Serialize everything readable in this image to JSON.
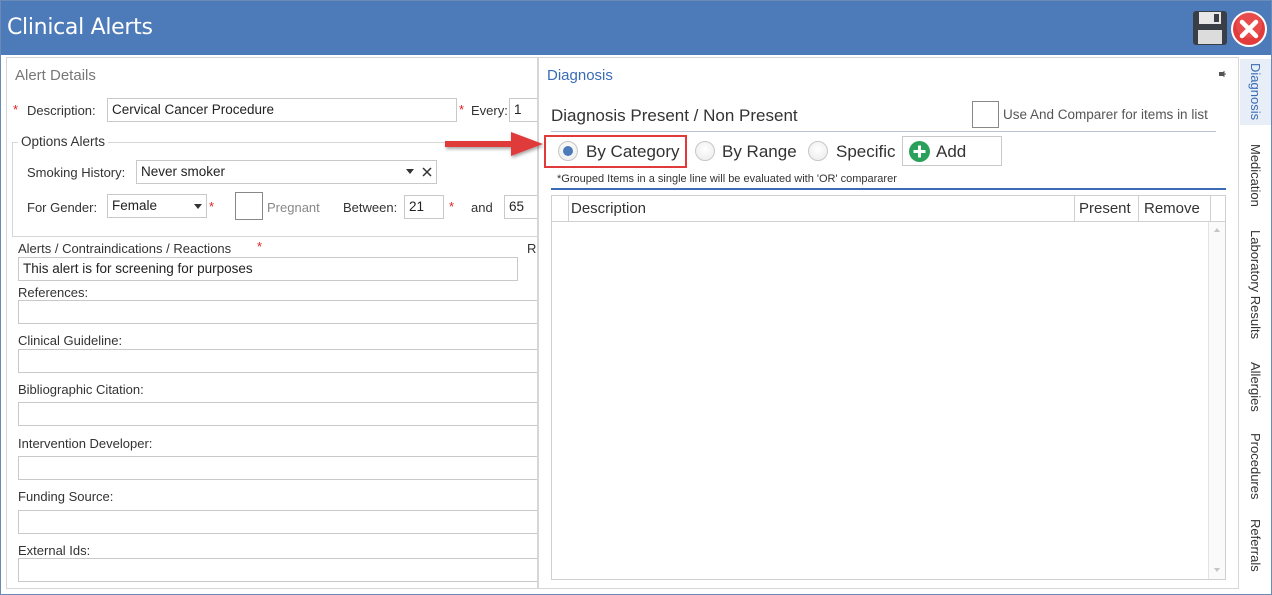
{
  "window": {
    "title": "Clinical Alerts"
  },
  "toolbar": {
    "save_icon": "floppy-disk-icon",
    "close_icon": "close-circle-icon"
  },
  "alert_details": {
    "title": "Alert Details",
    "description": {
      "label": "Description:",
      "value": "Cervical Cancer Procedure"
    },
    "every": {
      "label": "Every:",
      "value": "1"
    },
    "options": {
      "title": "Options Alerts",
      "smoking_history": {
        "label": "Smoking History:",
        "value": "Never smoker"
      },
      "gender": {
        "label": "For Gender:",
        "value": "Female"
      },
      "pregnant_label": "Pregnant",
      "between_label": "Between:",
      "age_from": "21",
      "and_label": "and",
      "age_to": "65"
    },
    "alerts": {
      "label": "Alerts / Contraindications / Reactions",
      "value": "This alert is for screening for purposes",
      "cut_label": "Re"
    },
    "references_label": "References:",
    "clinical_guideline_label": "Clinical Guideline:",
    "bibliographic_citation_label": "Bibliographic Citation:",
    "intervention_developer_label": "Intervention Developer:",
    "funding_source_label": "Funding Source:",
    "external_ids_label": "External Ids:"
  },
  "diagnosis": {
    "title": "Diagnosis",
    "heading": "Diagnosis Present / Non Present",
    "comparer_label": "Use And Comparer for items in list",
    "comparer_checked": false,
    "radios": [
      {
        "label": "By Category",
        "selected": true
      },
      {
        "label": "By Range",
        "selected": false
      },
      {
        "label": "Specific",
        "selected": false
      }
    ],
    "add_label": "Add",
    "note": "*Grouped Items in a single line will be evaluated with 'OR' compararer",
    "columns": [
      "Description",
      "Present",
      "Remove"
    ]
  },
  "side_tabs": [
    "Diagnosis",
    "Medication",
    "Laboratory Results",
    "Allergies",
    "Procedures",
    "Referrals"
  ],
  "colors": {
    "titlebar": "#4d7ab8",
    "required": "#e02020",
    "highlight": "#e03a3a",
    "accent": "#3a6cb5"
  }
}
